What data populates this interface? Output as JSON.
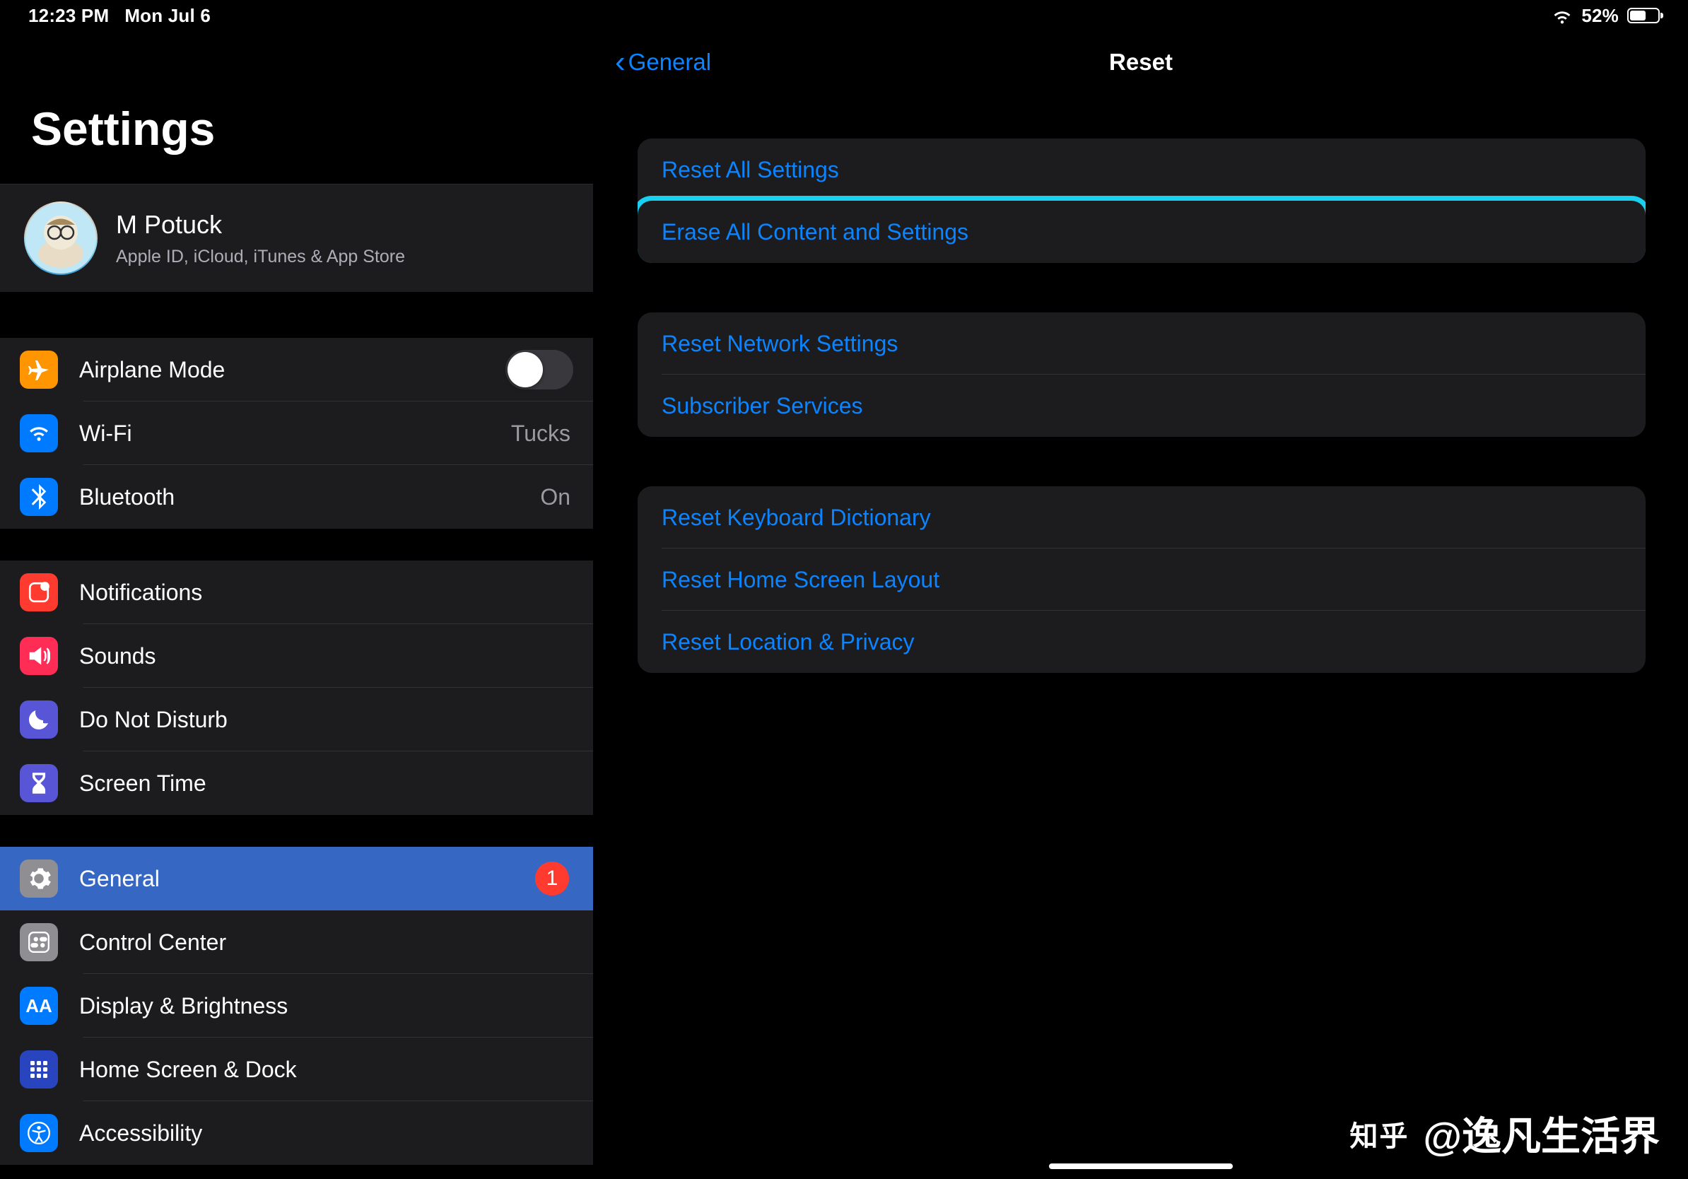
{
  "status": {
    "time": "12:23 PM",
    "date": "Mon Jul 6",
    "battery_pct": "52%"
  },
  "sidebar": {
    "title": "Settings",
    "apple": {
      "name": "M Potuck",
      "sub": "Apple ID, iCloud, iTunes & App Store"
    },
    "groups": [
      [
        {
          "id": "airplane",
          "label": "Airplane Mode",
          "toggle": true,
          "on": false
        },
        {
          "id": "wifi",
          "label": "Wi-Fi",
          "value": "Tucks"
        },
        {
          "id": "bluetooth",
          "label": "Bluetooth",
          "value": "On"
        }
      ],
      [
        {
          "id": "notifications",
          "label": "Notifications"
        },
        {
          "id": "sounds",
          "label": "Sounds"
        },
        {
          "id": "dnd",
          "label": "Do Not Disturb"
        },
        {
          "id": "screentime",
          "label": "Screen Time"
        }
      ],
      [
        {
          "id": "general",
          "label": "General",
          "badge": "1",
          "selected": true
        },
        {
          "id": "controlcenter",
          "label": "Control Center"
        },
        {
          "id": "display",
          "label": "Display & Brightness"
        },
        {
          "id": "homescreen",
          "label": "Home Screen & Dock"
        },
        {
          "id": "accessibility",
          "label": "Accessibility"
        }
      ]
    ]
  },
  "detail": {
    "back": "General",
    "title": "Reset",
    "groups": [
      [
        {
          "label": "Reset All Settings"
        },
        {
          "label": "Erase All Content and Settings",
          "highlight": true
        }
      ],
      [
        {
          "label": "Reset Network Settings"
        },
        {
          "label": "Subscriber Services"
        }
      ],
      [
        {
          "label": "Reset Keyboard Dictionary"
        },
        {
          "label": "Reset Home Screen Layout"
        },
        {
          "label": "Reset Location & Privacy"
        }
      ]
    ]
  },
  "watermark": {
    "brand": "知乎",
    "handle": "@逸凡生活界"
  }
}
